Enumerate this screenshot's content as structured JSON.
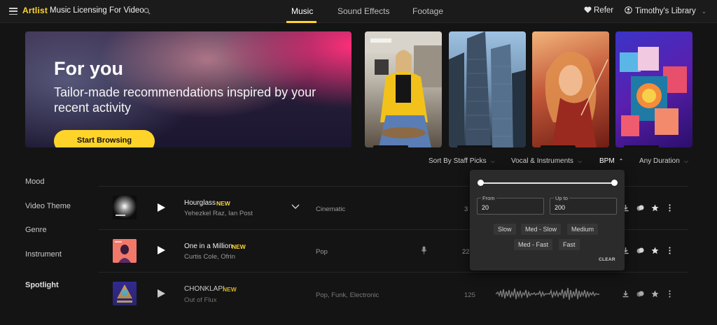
{
  "topbar": {
    "logo": "Artlist",
    "title": "Music Licensing For Video",
    "tabs": [
      {
        "label": "Music"
      },
      {
        "label": "Sound Effects"
      },
      {
        "label": "Footage"
      }
    ],
    "refer_label": "Refer",
    "library_label": "Timothy's Library"
  },
  "hero": {
    "title": "For you",
    "subtitle": "Tailor-made recommendations inspired by your recent activity",
    "button_label": "Start Browsing"
  },
  "filters": {
    "sort": "Sort By Staff Picks",
    "vocal": "Vocal & Instruments",
    "bpm": "BPM",
    "duration": "Any Duration"
  },
  "sidebar": {
    "items": [
      "Mood",
      "Video Theme",
      "Genre",
      "Instrument",
      "Spotlight"
    ]
  },
  "tracks": [
    {
      "title": "Hourglass",
      "badge": "NEW",
      "artists": "Yehezkel Raz, Ian Post",
      "genre": "Cinematic",
      "bpm": "3"
    },
    {
      "title": "One in a Million",
      "badge": "NEW",
      "artists": "Curtis Cole, Ofrin",
      "genre": "Pop",
      "bpm": "22"
    },
    {
      "title": "CHONKLAP!",
      "badge": "NEW",
      "artists": "Out of Flux",
      "genre": "Pop,  Funk,  Electronic",
      "bpm": "125"
    }
  ],
  "bpm_popover": {
    "from_label": "From",
    "from_value": "20",
    "to_label": "Up to",
    "to_value": "200",
    "chips": [
      "Slow",
      "Med - Slow",
      "Medium",
      "Med - Fast",
      "Fast"
    ],
    "clear_label": "CLEAR"
  },
  "colors": {
    "accent": "#ffd42a",
    "background": "#141414",
    "popover": "#2b2b2b"
  },
  "icons": {
    "menu": "hamburger-icon",
    "search": "search-icon",
    "heart": "heart-icon",
    "user": "user-icon",
    "play": "play-icon",
    "download": "download-icon",
    "similar": "similar-icon",
    "star": "star-icon",
    "more": "more-icon",
    "mic": "mic-icon",
    "chevron": "chevron-down-icon"
  }
}
